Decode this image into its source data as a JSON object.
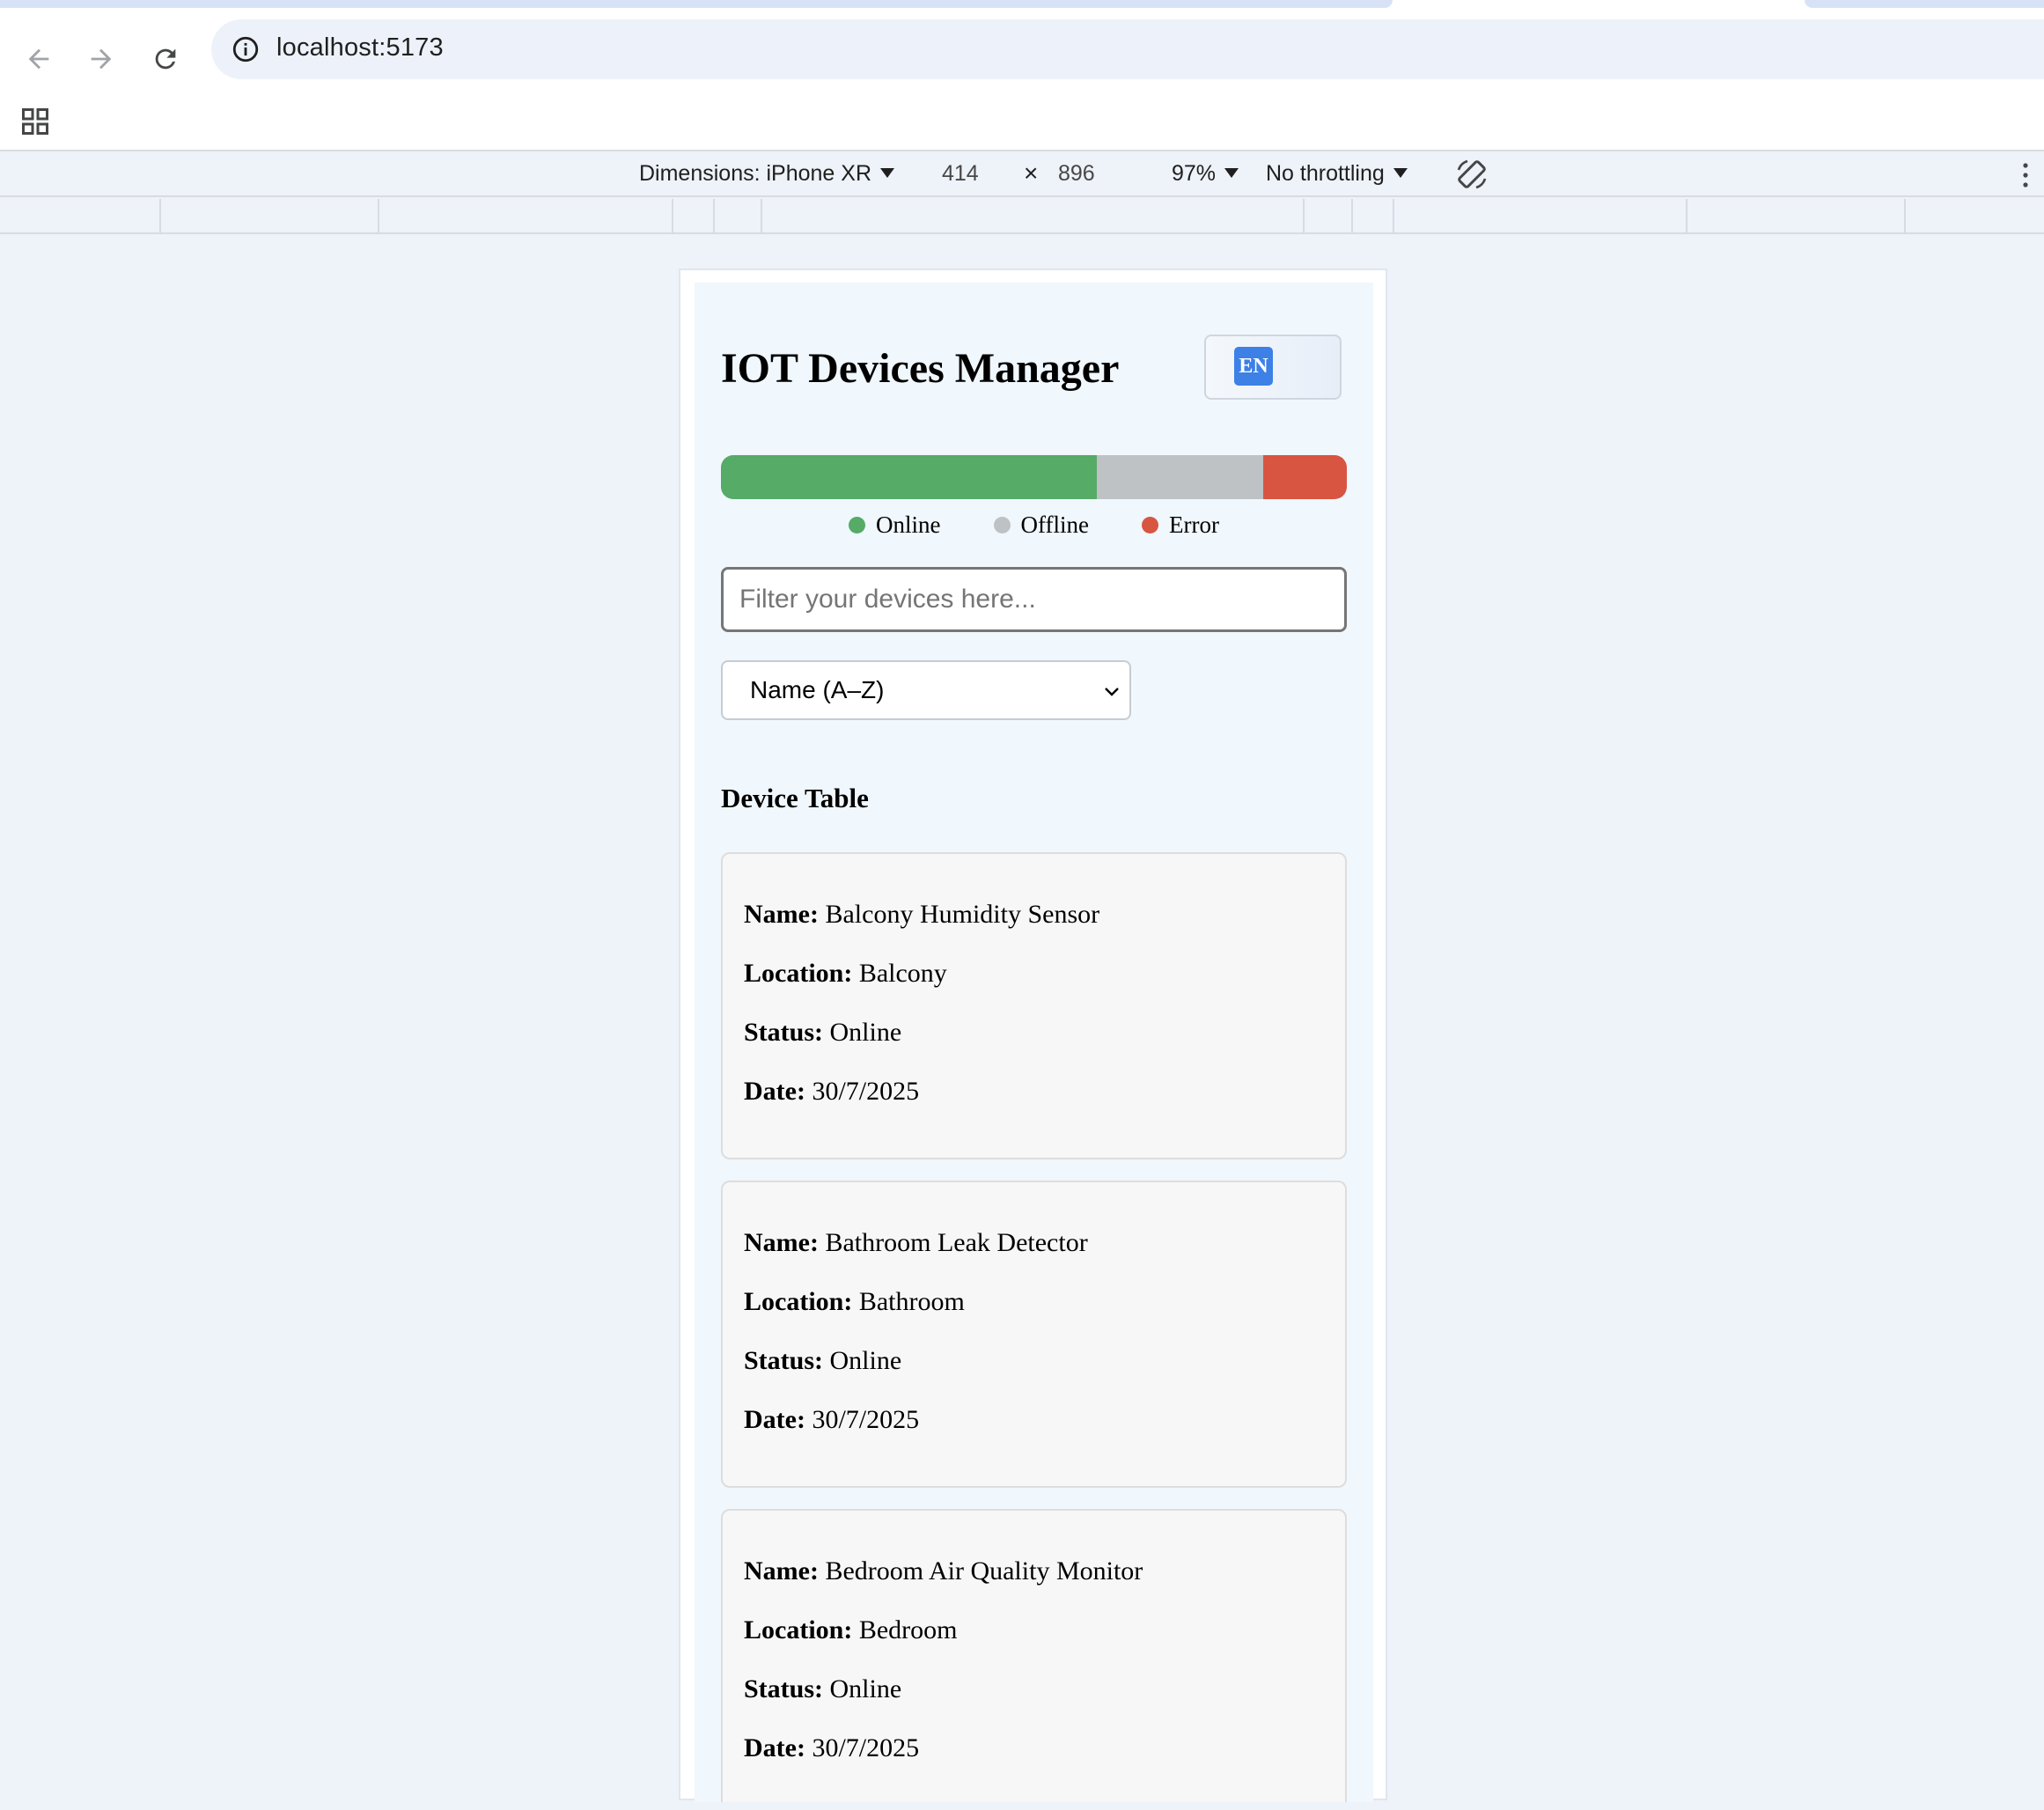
{
  "browser": {
    "url": "localhost:5173"
  },
  "devtools": {
    "dimensions_label": "Dimensions: iPhone XR",
    "width_value": "414",
    "times": "×",
    "height_value": "896",
    "zoom": "97%",
    "throttling": "No throttling"
  },
  "app": {
    "title": "IOT Devices Manager",
    "language_code": "EN",
    "status_distribution": {
      "online_fraction": 0.6,
      "offline_fraction": 0.267,
      "error_fraction": 0.133
    },
    "legend": {
      "online": "Online",
      "offline": "Offline",
      "error": "Error"
    },
    "colors": {
      "online": "#56ab67",
      "offline": "#bfc2c5",
      "error": "#d85542",
      "language_badge": "#3d80e6"
    },
    "filter_placeholder": "Filter your devices here...",
    "sort_selected": "Name (A–Z)",
    "section_title": "Device Table",
    "field_labels": {
      "name": "Name:",
      "location": "Location:",
      "status": "Status:",
      "date": "Date:"
    },
    "devices": [
      {
        "name": "Balcony Humidity Sensor",
        "location": "Balcony",
        "status": "Online",
        "date": "30/7/2025"
      },
      {
        "name": "Bathroom Leak Detector",
        "location": "Bathroom",
        "status": "Online",
        "date": "30/7/2025"
      },
      {
        "name": "Bedroom Air Quality Monitor",
        "location": "Bedroom",
        "status": "Online",
        "date": "30/7/2025"
      }
    ]
  }
}
